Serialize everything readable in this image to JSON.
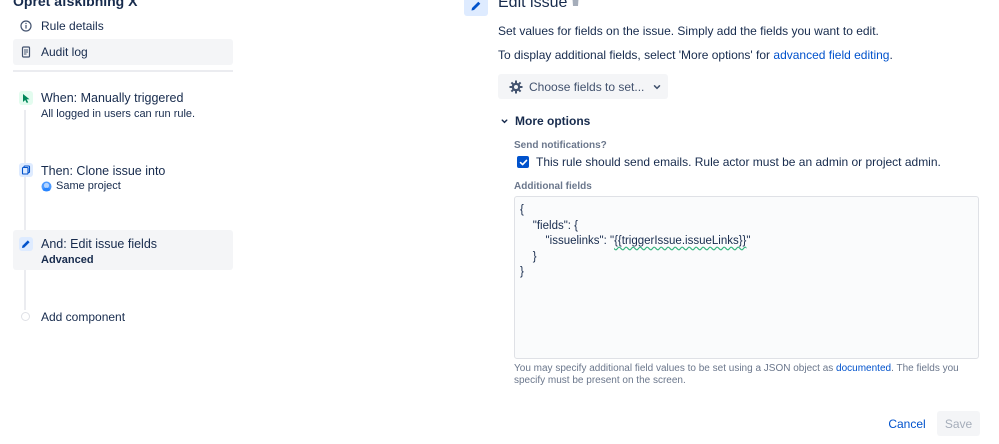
{
  "sidebar": {
    "rule_title": "Opret afskibning X",
    "items": [
      {
        "label": "Rule details",
        "icon": "info-icon"
      },
      {
        "label": "Audit log",
        "icon": "document-icon"
      }
    ]
  },
  "timeline": {
    "trigger": {
      "title": "When: Manually triggered",
      "subtitle": "All logged in users can run rule.",
      "icon": "cursor-icon"
    },
    "clone": {
      "title": "Then: Clone issue into",
      "subtitle": "Same project",
      "icon": "copy-icon"
    },
    "edit": {
      "title": "And: Edit issue fields",
      "subtitle": "Advanced",
      "icon": "pencil-icon"
    },
    "add_component": "Add component"
  },
  "editor": {
    "title": "Edit issue",
    "description": "Set values for fields on the issue. Simply add the fields you want to edit.",
    "additional_prefix": "To display additional fields, select 'More options' for ",
    "additional_link": "advanced field editing",
    "additional_suffix": ".",
    "choose_fields_label": "Choose fields to set...",
    "more_options_label": "More options",
    "send_notifications_label": "Send notifications?",
    "send_notifications_checkbox": "This rule should send emails. Rule actor must be an admin or project admin.",
    "send_notifications_checked": true,
    "additional_fields_label": "Additional fields",
    "code": {
      "l1": "{",
      "l2": "    \"fields\": {",
      "l3_prefix": "        \"issuelinks\": \"",
      "l3_template": "{{triggerIssue.issueLinks}}",
      "l3_suffix": "\"",
      "l4": "    }",
      "l5": "}"
    },
    "help_prefix": "You may specify additional field values to be set using a JSON object as ",
    "help_link": "documented",
    "help_suffix": ". The fields you specify must be present on the screen.",
    "cancel_label": "Cancel",
    "save_label": "Save"
  },
  "colors": {
    "accent": "#0052cc",
    "trigger_green": "#00875a",
    "step_blue": "#deebff"
  }
}
